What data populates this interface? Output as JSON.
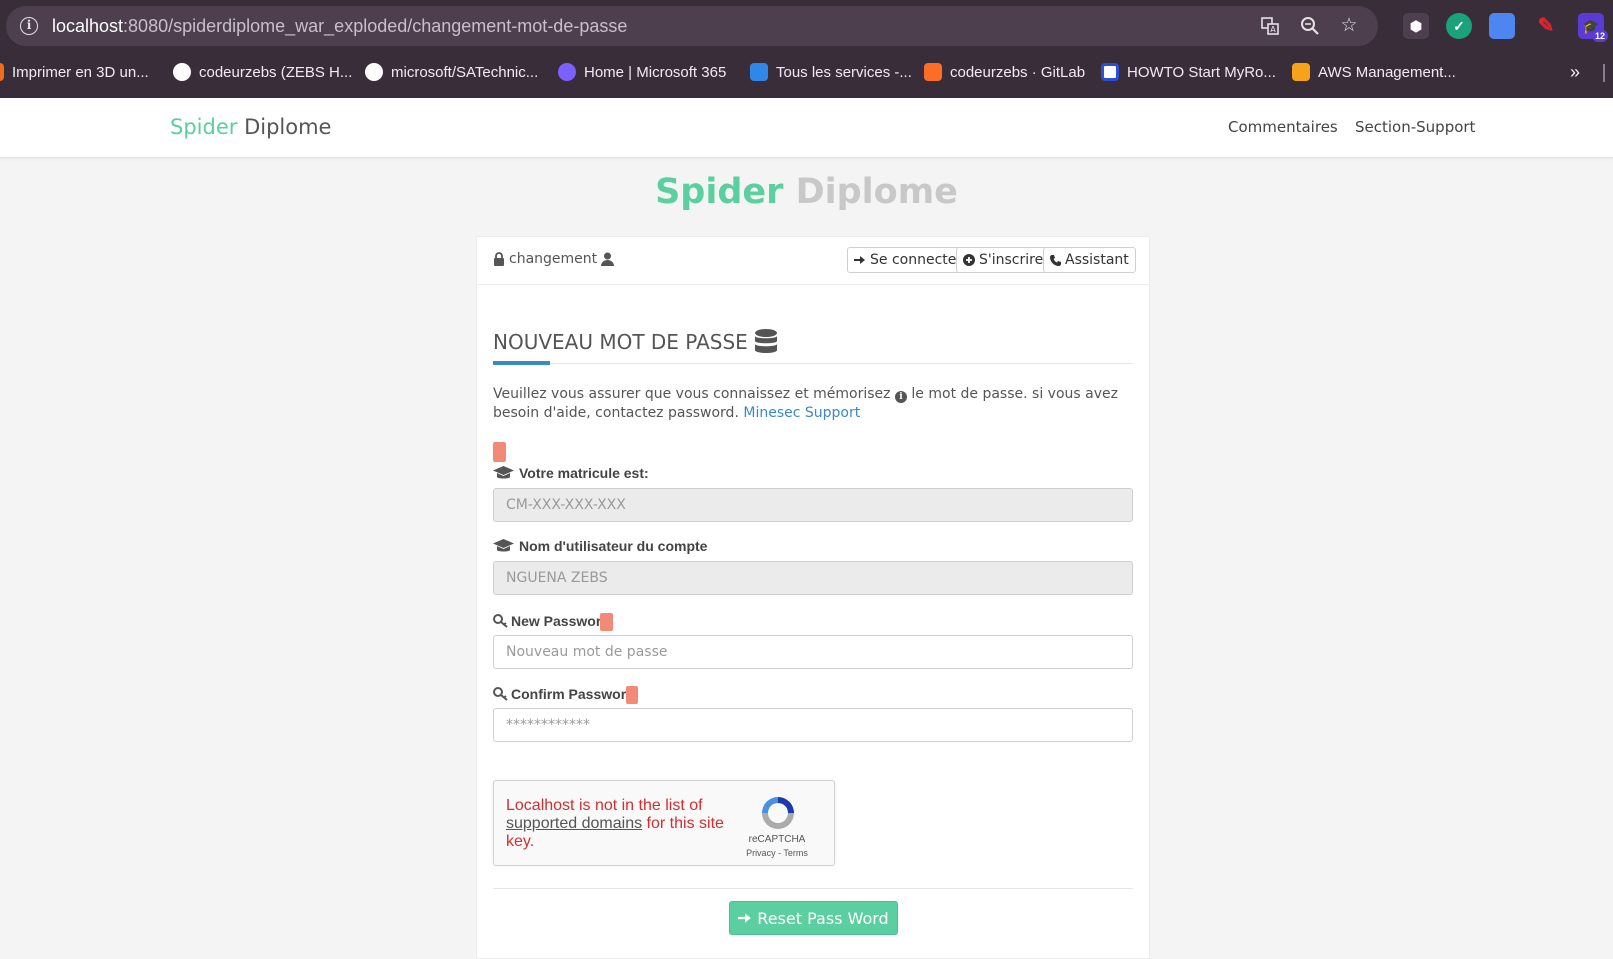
{
  "browser": {
    "url_host": "localhost",
    "url_path": ":8080/spiderdiplome_war_exploded/changement-mot-de-passe",
    "extension_badge": "12",
    "bookmarks": [
      {
        "label": "Imprimer en 3D un...",
        "icon": "bookmark-orange-icon",
        "color": "#f26a1b"
      },
      {
        "label": "codeurzebs (ZEBS H...",
        "icon": "github-icon",
        "color": "#ffffff"
      },
      {
        "label": "microsoft/SATechnic...",
        "icon": "github-icon",
        "color": "#ffffff"
      },
      {
        "label": "Home | Microsoft 365",
        "icon": "microsoft365-icon",
        "color": "#7b61ff"
      },
      {
        "label": "Tous les services -...",
        "icon": "azure-icon",
        "color": "#2f88e8"
      },
      {
        "label": "codeurzebs · GitLab",
        "icon": "gitlab-icon",
        "color": "#fc6d26"
      },
      {
        "label": "HOWTO Start MyRo...",
        "icon": "myro-icon",
        "color": "#2c4fd8"
      },
      {
        "label": "AWS Management...",
        "icon": "aws-icon",
        "color": "#f7a21b"
      }
    ]
  },
  "navbar": {
    "brand_a": "Spider",
    "brand_b": "Diplome",
    "links": [
      "Commentaires",
      "Section-Support"
    ]
  },
  "hero": {
    "title_a": "Spider",
    "title_b": "Diplome"
  },
  "card": {
    "crumb": "changement",
    "buttons": [
      "Se connecter",
      "S'inscrire",
      "Assistant"
    ]
  },
  "form": {
    "section_title": "NOUVEAU MOT DE PASSE",
    "description": "Veuillez vous assurer que vous connaissez et mémorisez",
    "description_2": "le mot de passe. si vous avez besoin d'aide, contactez password.",
    "support_link": "Minesec Support",
    "matricule_label": "Votre matricule est:",
    "matricule_value": "CM-XXX-XXX-XXX",
    "username_label": "Nom d'utilisateur du compte",
    "username_value": "NGUENA ZEBS",
    "new_password_label": "New Password",
    "new_password_placeholder": "Nouveau mot de passe",
    "confirm_password_label": "Confirm Password",
    "confirm_password_placeholder": "************",
    "submit_label": "Reset Pass Word"
  },
  "captcha": {
    "msg_a": "Localhost is not in the list of",
    "msg_link": "supported domains",
    "msg_b": "for this site key.",
    "name": "reCAPTCHA",
    "privacy": "Privacy",
    "terms": "Terms"
  },
  "colors": {
    "accent": "#5ccfa0",
    "link": "#3a89c9",
    "error": "#f38a77"
  }
}
